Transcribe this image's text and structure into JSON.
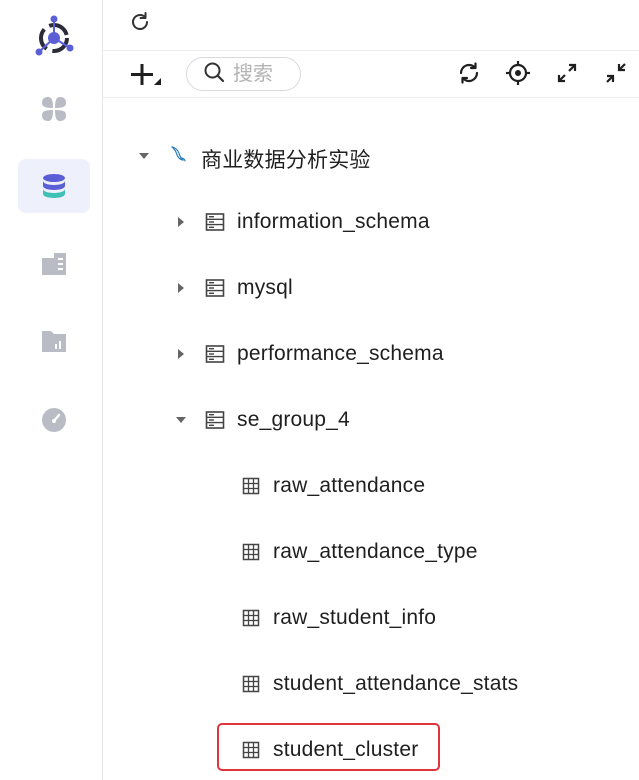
{
  "toolbar": {
    "search": {
      "placeholder": "搜索",
      "value": ""
    }
  },
  "tree": {
    "connection": {
      "label": "商业数据分析实验",
      "expanded": true,
      "icon": "mysql-dolphin-icon"
    },
    "databases": [
      {
        "label": "information_schema",
        "expanded": false
      },
      {
        "label": "mysql",
        "expanded": false
      },
      {
        "label": "performance_schema",
        "expanded": false
      },
      {
        "label": "se_group_4",
        "expanded": true,
        "tables": [
          {
            "label": "raw_attendance"
          },
          {
            "label": "raw_attendance_type"
          },
          {
            "label": "raw_student_info"
          },
          {
            "label": "student_attendance_stats"
          },
          {
            "label": "student_cluster",
            "highlighted": true
          }
        ]
      }
    ]
  },
  "colors": {
    "accent": "#5b5fd6",
    "active_nav_bg": "#eef0fb",
    "highlight_border": "#e0353b",
    "icon_gray": "#b9bcc4"
  },
  "sidebar": {
    "items": [
      {
        "icon": "apps-icon",
        "active": false
      },
      {
        "icon": "database-icon",
        "active": true
      },
      {
        "icon": "dashboard-icon",
        "active": false
      },
      {
        "icon": "folder-icon",
        "active": false
      },
      {
        "icon": "gauge-icon",
        "active": false
      }
    ]
  }
}
